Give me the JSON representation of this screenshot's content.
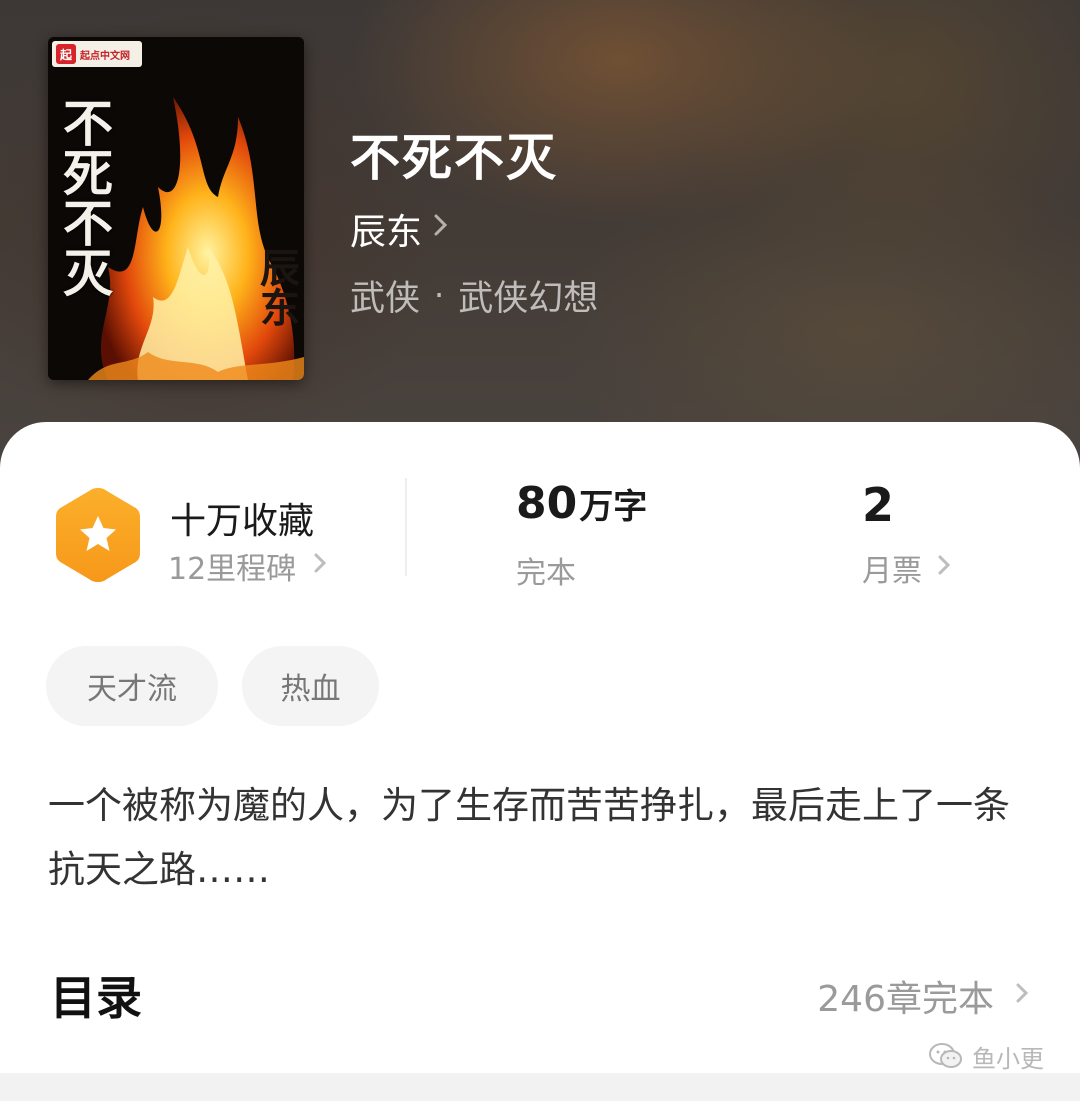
{
  "book": {
    "title": "不死不灭",
    "author": "辰东",
    "genre": "武侠",
    "subgenre": "武侠幻想",
    "genre_separator": "·"
  },
  "cover": {
    "badge_logo": "起",
    "badge_text": "起点中文网",
    "title": "不死不灭",
    "author": "辰东"
  },
  "stats": {
    "collect_label": "十万收藏",
    "milestone": "12里程碑",
    "word_count_value": "80",
    "word_count_unit": "万字",
    "status": "完本",
    "monthly_tickets_value": "2",
    "monthly_tickets_label": "月票"
  },
  "tags": [
    "天才流",
    "热血"
  ],
  "description": "一个被称为魔的人，为了生存而苦苦挣扎，最后走上了一条抗天之路……",
  "catalog": {
    "title": "目录",
    "count": "246章完本"
  },
  "watermark": "鱼小更",
  "icons": {
    "collect": "star-hexagon-icon",
    "chevron": "chevron-right-icon",
    "wechat": "wechat-icon"
  },
  "colors": {
    "accent": "#f9a41a",
    "header_bg": "#3d3836",
    "card_bg": "#ffffff",
    "muted_text": "#9a9a9a"
  }
}
